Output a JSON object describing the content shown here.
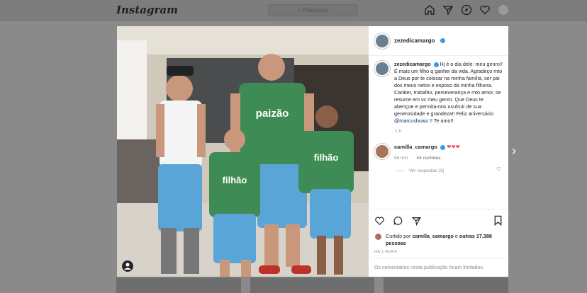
{
  "nav": {
    "logo": "Instagram",
    "search_placeholder": "Pesquisar",
    "icons": [
      "home-icon",
      "direct-icon",
      "explore-icon",
      "activity-icon",
      "profile-avatar"
    ]
  },
  "post": {
    "author": "zezedicamargo",
    "caption": "Hj é o dia dele: meu genro!! É mais um filho q ganhei da vida. Agradeço mto a Deus por te colocar na minha família, ser pai dos meus netos e esposo da minha filhona. Caráter, trabalho, perseverança e mto amor, se resume em vc meu genro. Que Deus te abençoe e permita-nos usufruir de sua generosidade e grandeza!! Feliz aniversário",
    "caption_mention": "@marcusbuaiz",
    "caption_end": "!! Te amo!!",
    "caption_time": "1 h",
    "image_texts": {
      "shirt_left": "paizão",
      "shirt_mid": "filhão",
      "shirt_right": "filhão"
    }
  },
  "comment": {
    "user": "camilla_camargo",
    "text": "❤❤❤",
    "time": "58 min",
    "likes": "44 curtidas",
    "view_replies": "Ver respostas (3)"
  },
  "likes": {
    "prefix": "Curtido por",
    "user": "camilla_camargo",
    "middle": "e",
    "others": "outras 17.388 pessoas"
  },
  "posted_ago": "HÁ 1 HORA",
  "comments_disabled": "Os comentários nesta publicação foram limitados."
}
